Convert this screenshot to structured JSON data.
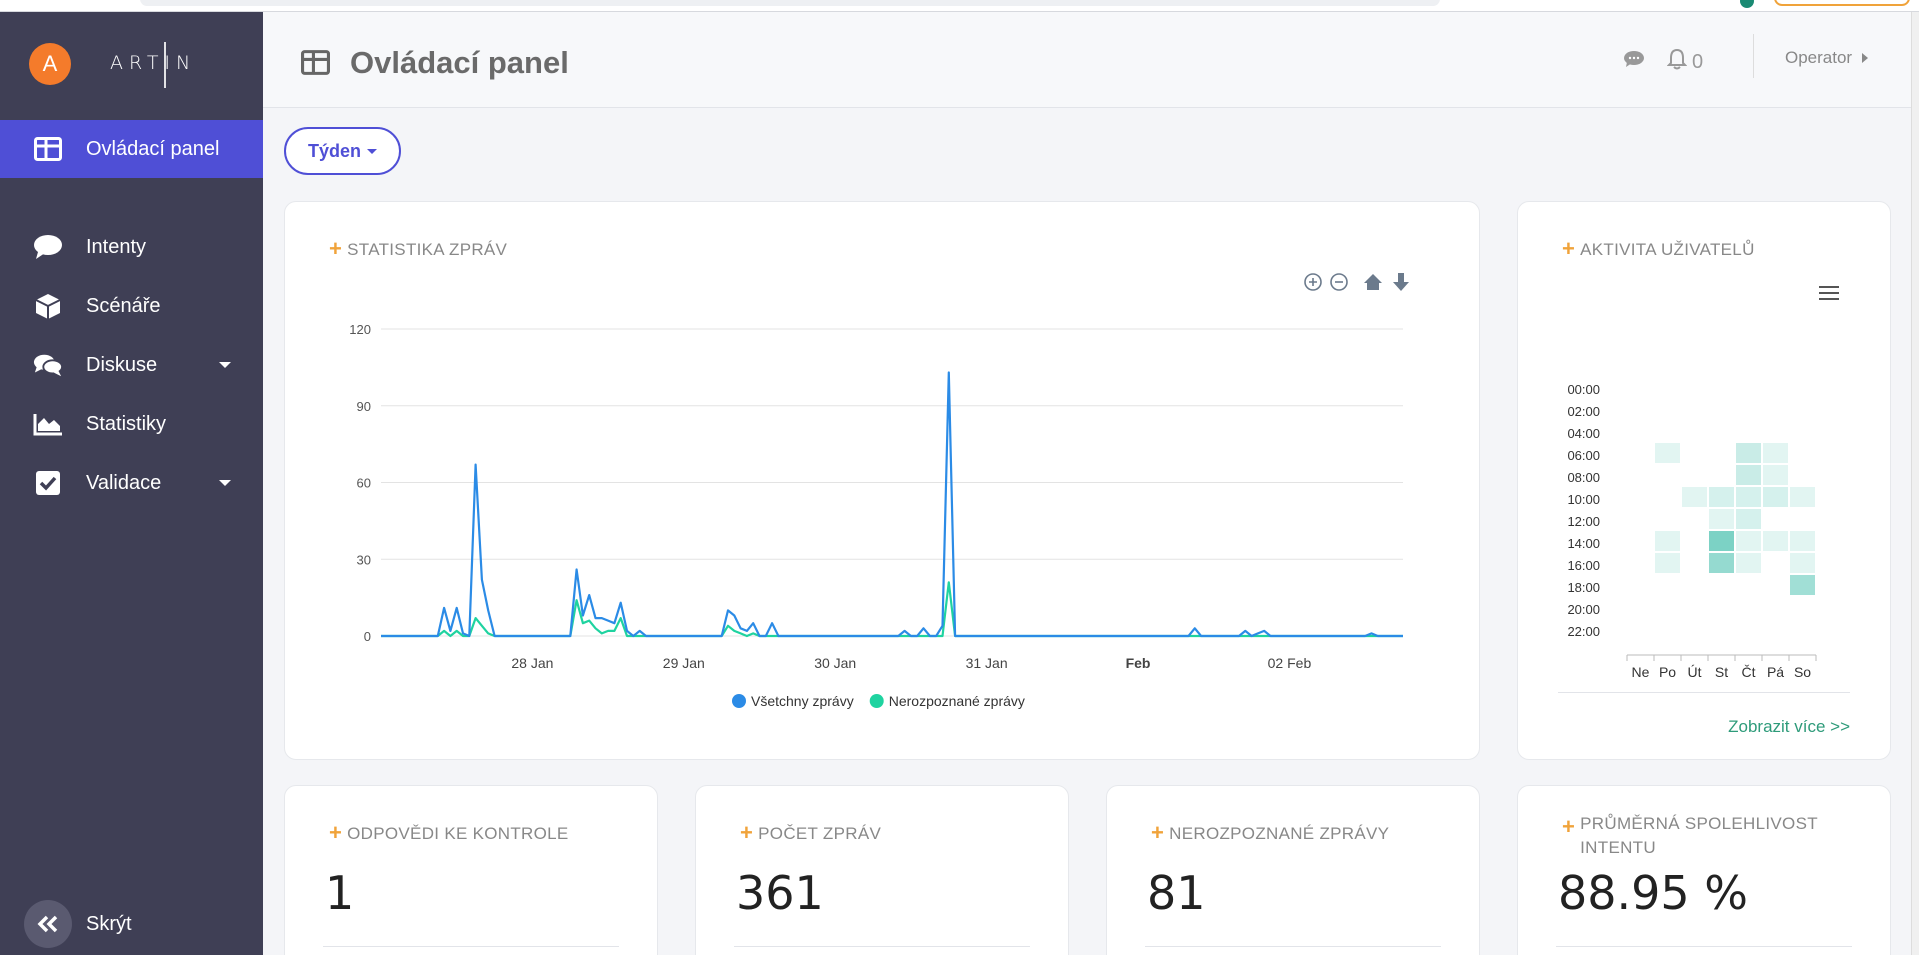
{
  "brand": {
    "avatar_letter": "A",
    "logo_text": "ARTIN"
  },
  "sidebar": {
    "items": [
      {
        "label": "Ovládací panel",
        "icon": "dashboard-icon",
        "active": true
      },
      {
        "label": "Intenty",
        "icon": "chat-bubble-icon"
      },
      {
        "label": "Scénáře",
        "icon": "cube-icon"
      },
      {
        "label": "Diskuse",
        "icon": "comments-icon",
        "dropdown": true
      },
      {
        "label": "Statistiky",
        "icon": "area-chart-icon"
      },
      {
        "label": "Validace",
        "icon": "checkbox-icon",
        "dropdown": true
      }
    ],
    "hide_label": "Skrýt"
  },
  "header": {
    "title": "Ovládací panel",
    "notification_count": "0",
    "user_label": "Operator"
  },
  "period": {
    "label": "Týden"
  },
  "message_stats": {
    "title": "STATISTIKA ZPRÁV",
    "toolbar": [
      "zoom-in-icon",
      "zoom-out-icon",
      "home-icon",
      "download-icon"
    ]
  },
  "user_activity": {
    "title": "AKTIVITA UŽIVATELŮ",
    "more_link": "Zobrazit více >>",
    "menu_icon": "menu-icon"
  },
  "kpis": [
    {
      "title": "ODPOVĚDI KE KONTROLE",
      "value": "1"
    },
    {
      "title": "POČET ZPRÁV",
      "value": "361"
    },
    {
      "title": "NEROZPOZNANÉ ZPRÁVY",
      "value": "81"
    },
    {
      "title": "PRŮMĚRNÁ SPOLEHLIVOST INTENTU",
      "value": "88.95 %"
    }
  ],
  "chart_data": [
    {
      "type": "line",
      "ylim": [
        0,
        120
      ],
      "yticks": [
        0,
        30,
        60,
        90,
        120
      ],
      "x_tick_labels": [
        "28 Jan",
        "29 Jan",
        "30 Jan",
        "31 Jan",
        "Feb",
        "02 Feb"
      ],
      "xlim": [
        "27 Jan 00:00",
        "02 Feb 18:00"
      ],
      "legend_position": "bottom",
      "series": [
        {
          "name": "Všetchny zprávy",
          "color": "#2b8be6",
          "points": [
            [
              "27 Jan 00:00",
              0
            ],
            [
              "27 Jan 09:00",
              0
            ],
            [
              "27 Jan 10:00",
              11
            ],
            [
              "27 Jan 11:00",
              2
            ],
            [
              "27 Jan 12:00",
              11
            ],
            [
              "27 Jan 13:00",
              1
            ],
            [
              "27 Jan 14:00",
              0
            ],
            [
              "27 Jan 15:00",
              67
            ],
            [
              "27 Jan 16:00",
              22
            ],
            [
              "27 Jan 17:00",
              10
            ],
            [
              "27 Jan 18:00",
              0
            ],
            [
              "28 Jan 00:00",
              0
            ],
            [
              "28 Jan 06:00",
              0
            ],
            [
              "28 Jan 07:00",
              26
            ],
            [
              "28 Jan 08:00",
              8
            ],
            [
              "28 Jan 09:00",
              16
            ],
            [
              "28 Jan 10:00",
              7
            ],
            [
              "28 Jan 11:00",
              7
            ],
            [
              "28 Jan 12:00",
              6
            ],
            [
              "28 Jan 13:00",
              5
            ],
            [
              "28 Jan 14:00",
              13
            ],
            [
              "28 Jan 15:00",
              2
            ],
            [
              "28 Jan 16:00",
              0
            ],
            [
              "28 Jan 17:00",
              2
            ],
            [
              "28 Jan 18:00",
              0
            ],
            [
              "29 Jan 00:00",
              0
            ],
            [
              "29 Jan 06:00",
              0
            ],
            [
              "29 Jan 07:00",
              10
            ],
            [
              "29 Jan 08:00",
              8
            ],
            [
              "29 Jan 09:00",
              3
            ],
            [
              "29 Jan 10:00",
              2
            ],
            [
              "29 Jan 11:00",
              5
            ],
            [
              "29 Jan 12:00",
              0
            ],
            [
              "29 Jan 13:00",
              0
            ],
            [
              "29 Jan 14:00",
              5
            ],
            [
              "29 Jan 15:00",
              0
            ],
            [
              "30 Jan 00:00",
              0
            ],
            [
              "30 Jan 10:00",
              0
            ],
            [
              "30 Jan 11:00",
              2
            ],
            [
              "30 Jan 12:00",
              0
            ],
            [
              "30 Jan 13:00",
              0
            ],
            [
              "30 Jan 14:00",
              3
            ],
            [
              "30 Jan 15:00",
              0
            ],
            [
              "30 Jan 16:00",
              0
            ],
            [
              "30 Jan 17:00",
              4
            ],
            [
              "30 Jan 18:00",
              103
            ],
            [
              "30 Jan 19:00",
              0
            ],
            [
              "31 Jan 00:00",
              0
            ],
            [
              "01 Feb 00:00",
              0
            ],
            [
              "01 Feb 08:00",
              0
            ],
            [
              "01 Feb 09:00",
              3
            ],
            [
              "01 Feb 10:00",
              0
            ],
            [
              "01 Feb 16:00",
              0
            ],
            [
              "01 Feb 17:00",
              2
            ],
            [
              "01 Feb 18:00",
              0
            ],
            [
              "01 Feb 19:00",
              1
            ],
            [
              "01 Feb 20:00",
              2
            ],
            [
              "01 Feb 21:00",
              0
            ],
            [
              "02 Feb 00:00",
              0
            ],
            [
              "02 Feb 12:00",
              0
            ],
            [
              "02 Feb 13:00",
              1
            ],
            [
              "02 Feb 14:00",
              0
            ],
            [
              "02 Feb 18:00",
              0
            ]
          ]
        },
        {
          "name": "Nerozpoznané zprávy",
          "color": "#1fd3a0",
          "points": [
            [
              "27 Jan 00:00",
              0
            ],
            [
              "27 Jan 09:00",
              0
            ],
            [
              "27 Jan 10:00",
              2
            ],
            [
              "27 Jan 11:00",
              0
            ],
            [
              "27 Jan 12:00",
              2
            ],
            [
              "27 Jan 13:00",
              0
            ],
            [
              "27 Jan 14:00",
              0
            ],
            [
              "27 Jan 15:00",
              7
            ],
            [
              "27 Jan 16:00",
              4
            ],
            [
              "27 Jan 17:00",
              1
            ],
            [
              "27 Jan 18:00",
              0
            ],
            [
              "28 Jan 00:00",
              0
            ],
            [
              "28 Jan 06:00",
              0
            ],
            [
              "28 Jan 07:00",
              14
            ],
            [
              "28 Jan 08:00",
              5
            ],
            [
              "28 Jan 09:00",
              6
            ],
            [
              "28 Jan 10:00",
              3
            ],
            [
              "28 Jan 11:00",
              1
            ],
            [
              "28 Jan 12:00",
              2
            ],
            [
              "28 Jan 13:00",
              2
            ],
            [
              "28 Jan 14:00",
              7
            ],
            [
              "28 Jan 15:00",
              0
            ],
            [
              "29 Jan 00:00",
              0
            ],
            [
              "29 Jan 06:00",
              0
            ],
            [
              "29 Jan 07:00",
              4
            ],
            [
              "29 Jan 08:00",
              2
            ],
            [
              "29 Jan 09:00",
              1
            ],
            [
              "29 Jan 10:00",
              0
            ],
            [
              "29 Jan 11:00",
              1
            ],
            [
              "29 Jan 12:00",
              0
            ],
            [
              "30 Jan 00:00",
              0
            ],
            [
              "30 Jan 17:00",
              0
            ],
            [
              "30 Jan 18:00",
              21
            ],
            [
              "30 Jan 19:00",
              0
            ],
            [
              "02 Feb 18:00",
              0
            ]
          ]
        }
      ]
    },
    {
      "type": "heatmap",
      "columns": [
        "Ne",
        "Po",
        "Út",
        "St",
        "Čt",
        "Pá",
        "So"
      ],
      "rows": [
        "00:00",
        "02:00",
        "04:00",
        "06:00",
        "08:00",
        "10:00",
        "12:00",
        "14:00",
        "16:00",
        "18:00",
        "20:00",
        "22:00"
      ],
      "values": [
        [
          0,
          0,
          0,
          0,
          0,
          0,
          0
        ],
        [
          0,
          0,
          0,
          0,
          0,
          0,
          0
        ],
        [
          0,
          0,
          0,
          0,
          0,
          0,
          0
        ],
        [
          0,
          1,
          0,
          0,
          3,
          1,
          0
        ],
        [
          0,
          0,
          0,
          0,
          3,
          1,
          0
        ],
        [
          0,
          0,
          1,
          2,
          2,
          2,
          1
        ],
        [
          0,
          0,
          0,
          1,
          2,
          0,
          0
        ],
        [
          0,
          1,
          0,
          9,
          1,
          1,
          1
        ],
        [
          0,
          1,
          0,
          7,
          1,
          0,
          1
        ],
        [
          0,
          0,
          0,
          0,
          0,
          0,
          6
        ],
        [
          0,
          0,
          0,
          0,
          0,
          0,
          0
        ],
        [
          0,
          0,
          0,
          0,
          0,
          0,
          0
        ]
      ]
    }
  ]
}
